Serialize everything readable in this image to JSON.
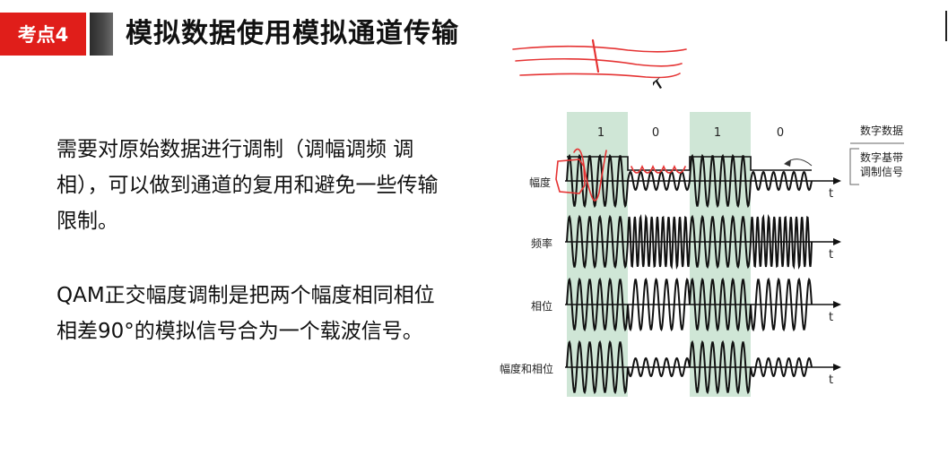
{
  "header": {
    "badge": "考点4",
    "title": "模拟数据使用模拟通道传输"
  },
  "body": {
    "paragraph1": "需要对原始数据进行调制（调幅调频 调相），可以做到通道的复用和避免一些传输限制。",
    "paragraph2": "QAM正交幅度调制是把两个幅度相同相位相差90°的模拟信号合为一个载波信号。"
  },
  "diagram": {
    "bits": [
      "1",
      "0",
      "1",
      "0"
    ],
    "legend": {
      "digital_data": "数字数据",
      "baseband_line1": "数字基带",
      "baseband_line2": "调制信号"
    },
    "rows": [
      {
        "label": "幅度",
        "axis": "t"
      },
      {
        "label": "频率",
        "axis": "t"
      },
      {
        "label": "相位",
        "axis": "t"
      },
      {
        "label": "幅度和相位",
        "axis": "t"
      }
    ],
    "colors": {
      "highlight": "#cfe6d6",
      "wave": "#111111",
      "annotation": "#e53333",
      "badge": "#e01e1a"
    }
  }
}
